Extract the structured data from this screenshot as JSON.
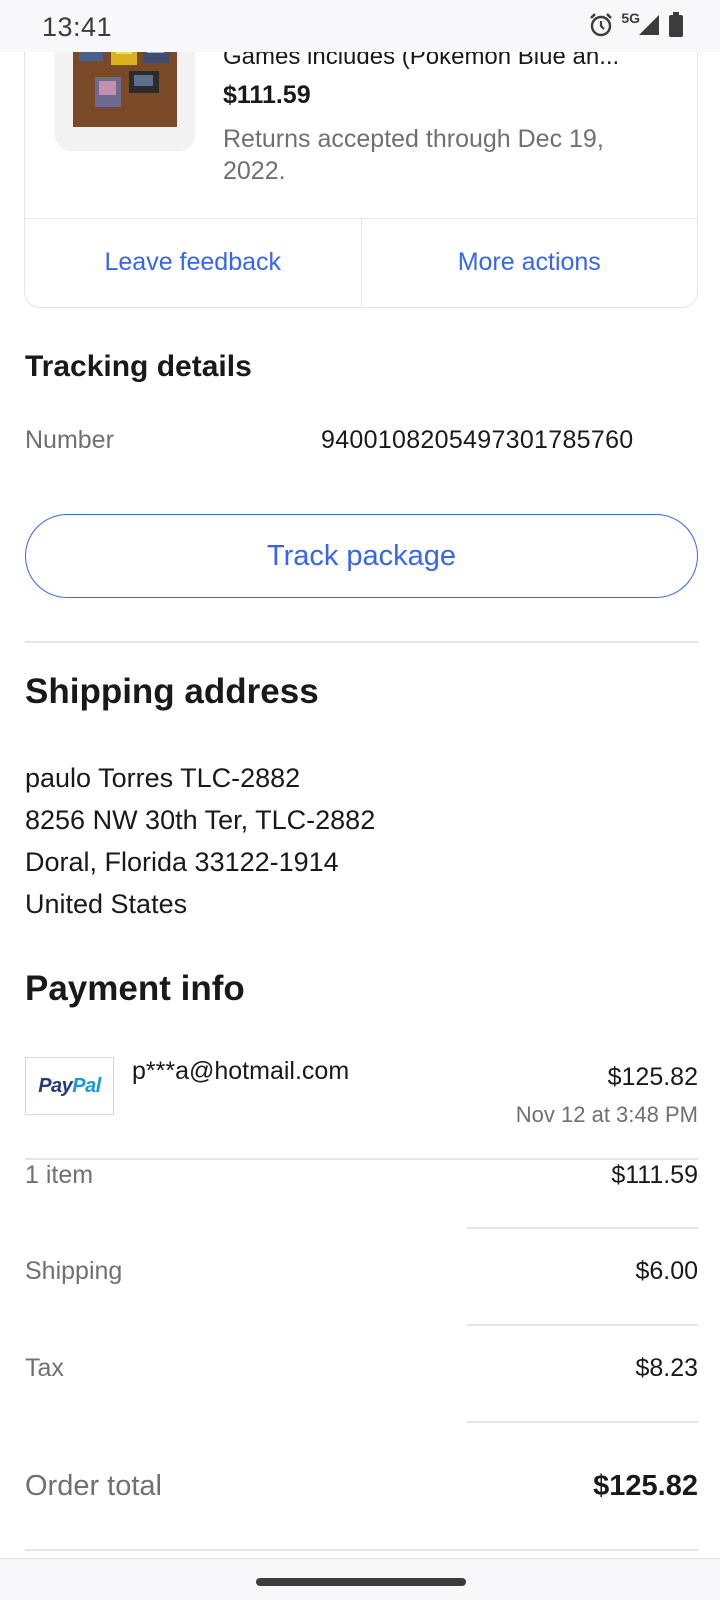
{
  "status_bar": {
    "time": "13:41",
    "network": "5G",
    "icons": [
      "alarm-icon",
      "signal-icon",
      "battery-icon"
    ]
  },
  "item": {
    "title": "Games includes (Pokemon Blue an...",
    "price": "$111.59",
    "returns": "Returns accepted through Dec 19, 2022.",
    "actions": {
      "leave_feedback": "Leave feedback",
      "more_actions": "More actions"
    }
  },
  "tracking": {
    "title": "Tracking details",
    "number_label": "Number",
    "number_value": "9400108205497301785760",
    "track_button": "Track package"
  },
  "shipping": {
    "title": "Shipping address",
    "lines": [
      "paulo Torres TLC-2882",
      "8256 NW 30th Ter, TLC-2882",
      "Doral, Florida 33122-1914",
      "United States"
    ]
  },
  "payment": {
    "title": "Payment info",
    "logo_text_a": "Pay",
    "logo_text_b": "Pal",
    "email": "p***a@hotmail.com",
    "amount": "$125.82",
    "date": "Nov 12 at 3:48 PM"
  },
  "summary": {
    "rows": [
      {
        "label": "1 item",
        "value": "$111.59"
      },
      {
        "label": "Shipping",
        "value": "$6.00"
      },
      {
        "label": "Tax",
        "value": "$8.23"
      }
    ],
    "total_label": "Order total",
    "total_value": "$125.82"
  },
  "colors": {
    "accent": "#3665f3",
    "text": "#191919",
    "secondary_text": "#707070",
    "divider": "#e5e5e5",
    "paypal_dark": "#253b80",
    "paypal_light": "#179bd7"
  }
}
